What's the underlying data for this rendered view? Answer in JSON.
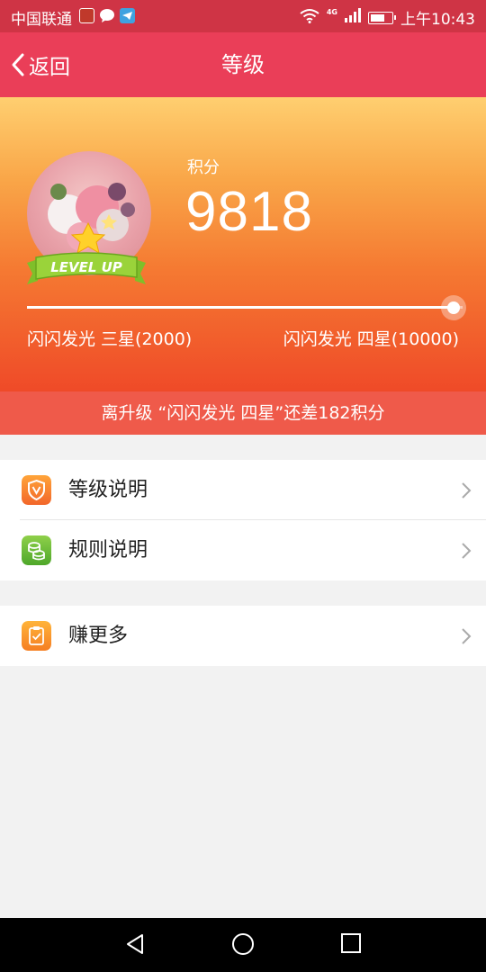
{
  "status_bar": {
    "carrier": "中国联通",
    "time": "上午10:43",
    "network": "4G"
  },
  "titlebar": {
    "back_label": "返回",
    "title": "等级"
  },
  "points": {
    "label": "积分",
    "value": "9818"
  },
  "avatar": {
    "banner_text": "LEVEL UP"
  },
  "progress": {
    "fraction": 0.98,
    "current_level": "闪闪发光 三星(2000)",
    "next_level": "闪闪发光 四星(10000)"
  },
  "upgrade_message": "离升级 “闪闪发光 四星”还差182积分",
  "menu_group_1": [
    {
      "label": "等级说明",
      "icon": "shield-v-icon"
    },
    {
      "label": "规则说明",
      "icon": "coins-icon"
    }
  ],
  "menu_group_2": [
    {
      "label": "赚更多",
      "icon": "clipboard-check-icon"
    }
  ],
  "colors": {
    "title_bar": "#ea3e58",
    "status_bar": "#cf3445",
    "header_top": "#ffcf70",
    "header_bottom": "#ef4a28",
    "upgrade_strip": "#ef5a4a"
  }
}
